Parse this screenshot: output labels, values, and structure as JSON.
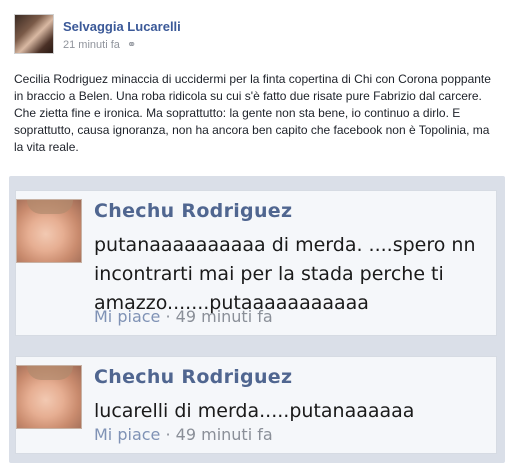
{
  "post": {
    "author": "Selvaggia Lucarelli",
    "time": "21 minuti fa",
    "text": "Cecilia Rodriguez minaccia di uccidermi per la finta copertina di Chi con Corona poppante in braccio a Belen. Una roba ridicola su cui s'è fatto due risate pure Fabrizio dal carcere. Che zietta fine e ironica. Ma soprattutto: la gente non sta bene, io continuo a dirlo. E soprattutto, causa ignoranza, non ha ancora ben capito che facebook non è Topolinia, ma la vita reale."
  },
  "comments": [
    {
      "name": "Chechu Rodriguez",
      "text": "putanaaaaaaaaaa di merda. ....spero nn incontrarti mai per la stada perche ti amazzo.......putaaaaaaaaaaa",
      "like": "Mi piace",
      "separator": " · ",
      "time": "49 minuti fa"
    },
    {
      "name": "Chechu Rodriguez",
      "text": "lucarelli di merda.....putanaaaaaa",
      "like": "Mi piace",
      "separator": " · ",
      "time": "49 minuti fa"
    }
  ],
  "icons": {
    "privacy": "globe-icon"
  }
}
